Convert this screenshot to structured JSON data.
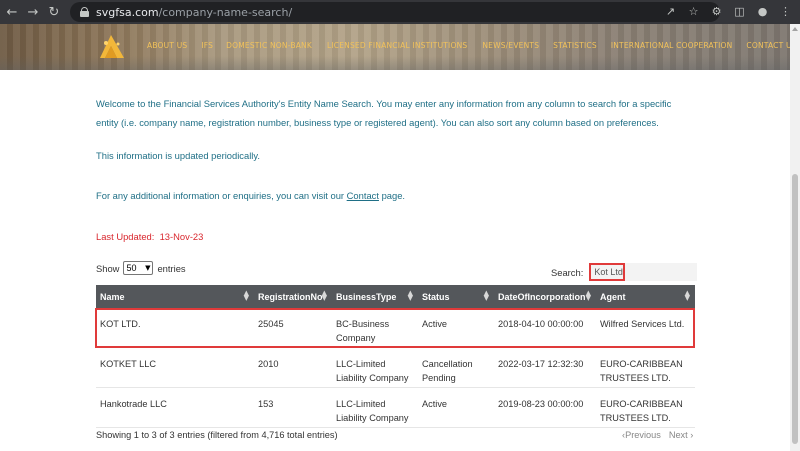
{
  "browser": {
    "url_domain": "svgfsa.com",
    "url_path": "/company-name-search/"
  },
  "nav": {
    "items": [
      "ABOUT US",
      "IFS",
      "DOMESTIC NON-BANK",
      "LICENSED FINANCIAL INSTITUTIONS",
      "NEWS/EVENTS",
      "STATISTICS",
      "INTERNATIONAL COOPERATION",
      "CONTACT US"
    ]
  },
  "content": {
    "intro": "Welcome to the Financial Services Authority's Entity Name Search. You may enter any information from any column to search for a specific entity (i.e. company name, registration number, business type or registered agent). You can also sort any column based on preferences.",
    "periodic": "This information is updated periodically.",
    "enquiries_before": "For any additional information or enquiries, you can visit our ",
    "enquiries_link": "Contact",
    "enquiries_after": " page.",
    "last_updated_label": "Last Updated:",
    "last_updated_value": "13-Nov-23"
  },
  "controls": {
    "show_label": "Show",
    "entries_value": "50",
    "entries_label": "entries",
    "search_label": "Search:",
    "search_value": "Kot Ltd"
  },
  "table": {
    "headers": [
      "Name",
      "RegistrationNo",
      "BusinessType",
      "Status",
      "DateOfIncorporation",
      "Agent"
    ],
    "rows": [
      {
        "name": "KOT LTD.",
        "reg": "25045",
        "type": "BC-Business Company",
        "status": "Active",
        "date": "2018-04-10 00:00:00",
        "agent": "Wilfred Services Ltd."
      },
      {
        "name": "KOTKET LLC",
        "reg": "2010",
        "type": "LLC-Limited Liability Company",
        "status": "Cancellation Pending",
        "date": "2022-03-17 12:32:30",
        "agent": "EURO-CARIBBEAN TRUSTEES LTD."
      },
      {
        "name": "Hankotrade LLC",
        "reg": "153",
        "type": "LLC-Limited Liability Company",
        "status": "Active",
        "date": "2019-08-23 00:00:00",
        "agent": "EURO-CARIBBEAN TRUSTEES LTD."
      }
    ]
  },
  "footer": {
    "info": "Showing 1 to 3 of 3 entries (filtered from 4,716 total entries)",
    "previous": "Previous",
    "next": "Next"
  },
  "colors": {
    "nav_text": "#f2c25a",
    "content_text": "#1f6f86",
    "last_updated": "#d9272e",
    "table_header": "#54575b",
    "highlight": "#e03a3a"
  }
}
